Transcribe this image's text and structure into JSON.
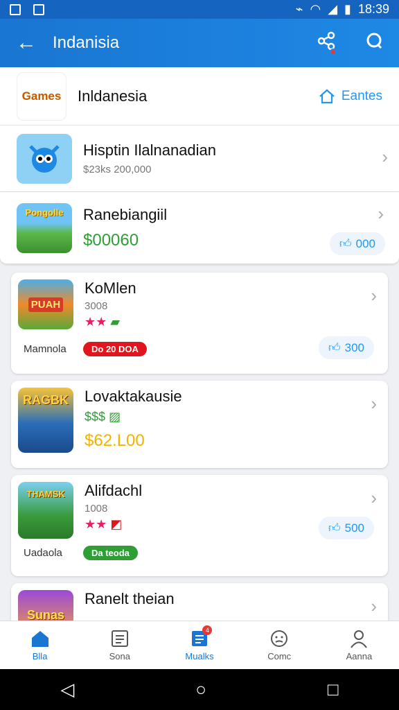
{
  "status": {
    "time": "18:39"
  },
  "appbar": {
    "title": "Indanisia",
    "back_icon": "arrow-left-icon",
    "share_icon": "share-icon",
    "search_icon": "search-icon"
  },
  "category": {
    "name": "Inldanesia",
    "logo_text": "Games",
    "link_label": "Eantes",
    "link_icon": "home-icon"
  },
  "items": [
    {
      "name": "Hisptin Ilalnanadian",
      "sub": "$23ks 200,000",
      "thumb_text": ""
    },
    {
      "name": "Ranebiangiil",
      "price": "$00060",
      "likes": "000",
      "thumb_text": "Pongolle"
    },
    {
      "name": "KoMlen",
      "sub": "3008",
      "stars": "★★",
      "left_label": "Mamnola",
      "badge": "Do 20 DOA",
      "likes": "300",
      "thumb_text": "PUAH"
    },
    {
      "name": "Lovaktakausie",
      "sub": "$$$",
      "price": "$62.L00",
      "thumb_text": "RAGBK"
    },
    {
      "name": "Alifdachl",
      "sub": "1008",
      "stars": "★★",
      "left_label": "Uadaola",
      "badge": "Da teoda",
      "likes": "500",
      "thumb_text": "THAMSK"
    },
    {
      "name": "Ranelt theian",
      "thumb_text": "Sunas"
    }
  ],
  "nav": [
    {
      "label": "Blla",
      "icon": "home-icon"
    },
    {
      "label": "Sona",
      "icon": "list-icon"
    },
    {
      "label": "Mualks",
      "icon": "news-icon",
      "badge": "4"
    },
    {
      "label": "Comc",
      "icon": "face-icon"
    },
    {
      "label": "Aanna",
      "icon": "person-icon"
    }
  ],
  "colors": {
    "primary": "#1976d2",
    "green": "#2e9e35",
    "orange": "#f2b300",
    "red_badge": "#e0161e"
  }
}
